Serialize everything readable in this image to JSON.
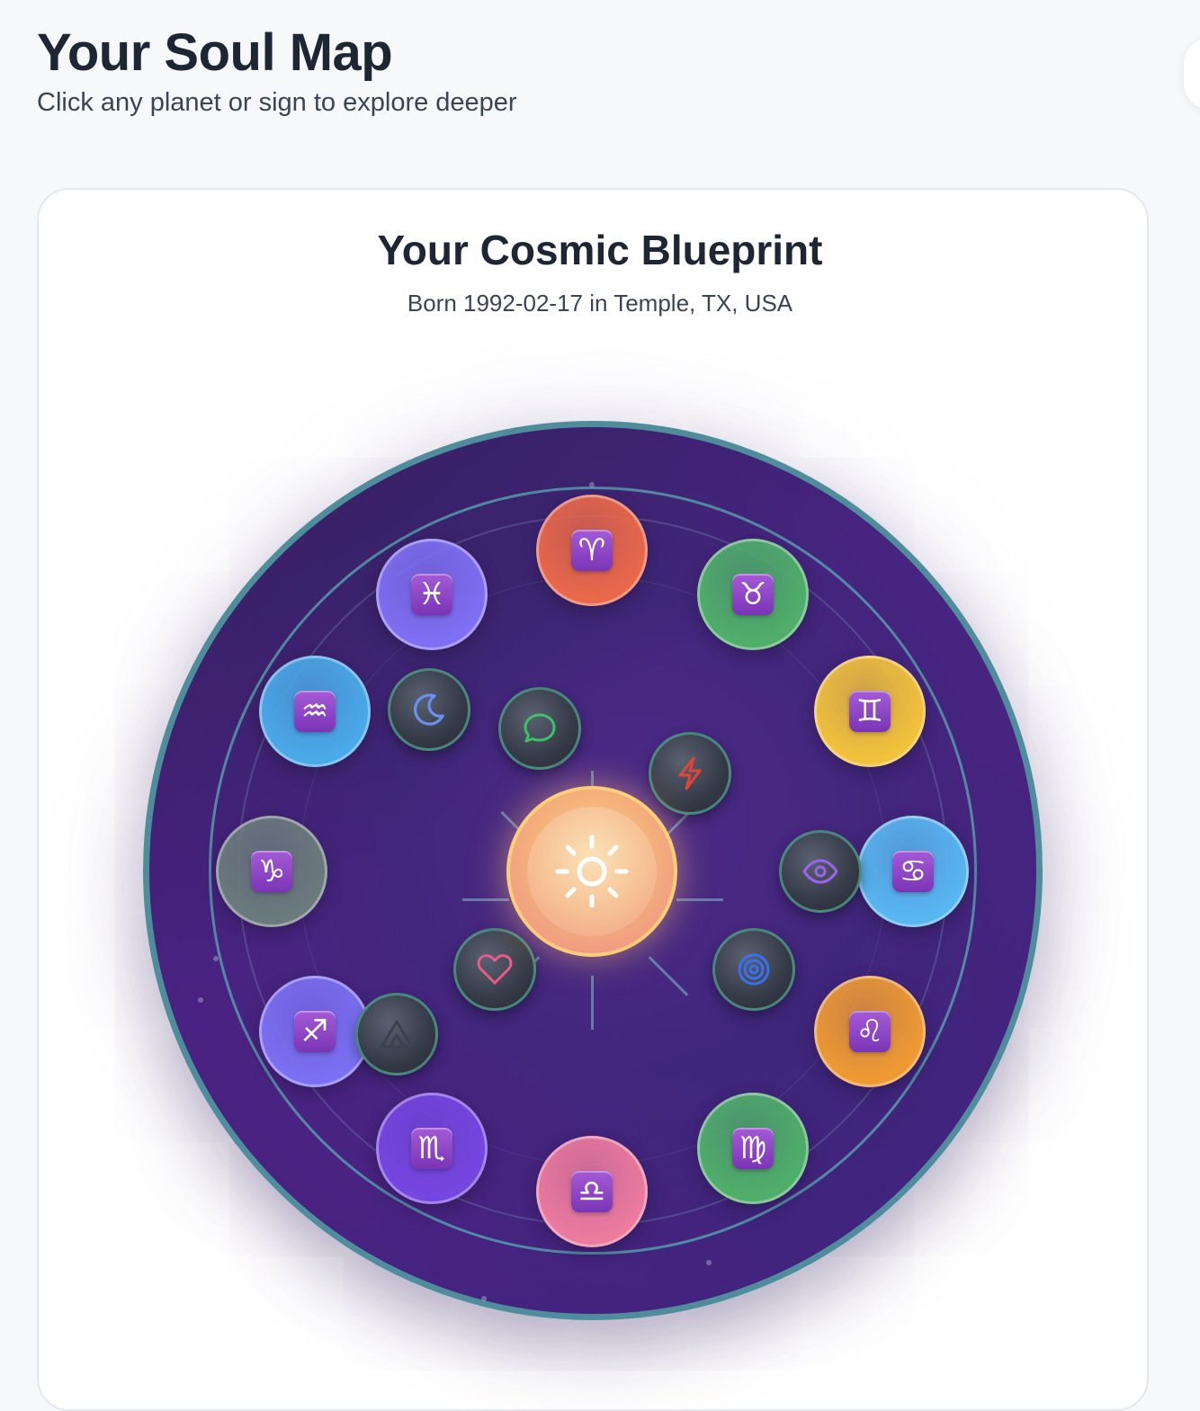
{
  "page": {
    "title": "Your Soul Map",
    "subtitle": "Click any planet or sign to explore deeper"
  },
  "card": {
    "title": "Your Cosmic Blueprint",
    "subtitle": "Born 1992-02-17 in Temple, TX, USA"
  },
  "signs": [
    {
      "name": "aries",
      "glyph": "♈",
      "color": "#e8684a"
    },
    {
      "name": "taurus",
      "glyph": "♉",
      "color": "#4fae6a"
    },
    {
      "name": "gemini",
      "glyph": "♊",
      "color": "#f2c23c"
    },
    {
      "name": "cancer",
      "glyph": "♋",
      "color": "#58b6f0"
    },
    {
      "name": "leo",
      "glyph": "♌",
      "color": "#ee9a34"
    },
    {
      "name": "virgo",
      "glyph": "♍",
      "color": "#4fae6a"
    },
    {
      "name": "libra",
      "glyph": "♎",
      "color": "#ec7b9e"
    },
    {
      "name": "scorpio",
      "glyph": "♏",
      "color": "#7646e0"
    },
    {
      "name": "sagittarius",
      "glyph": "♐",
      "color": "#7b70f2"
    },
    {
      "name": "capricorn",
      "glyph": "♑",
      "color": "#6b7a7c"
    },
    {
      "name": "aquarius",
      "glyph": "♒",
      "color": "#4aa9e8"
    },
    {
      "name": "pisces",
      "glyph": "♓",
      "color": "#7f6ff2"
    }
  ],
  "planets": [
    {
      "name": "sun",
      "icon": "sun-icon",
      "color": "#ffffff"
    },
    {
      "name": "moon",
      "icon": "moon-icon",
      "color": "#6a8ff0"
    },
    {
      "name": "mercury",
      "icon": "chat-bubble-icon",
      "color": "#3fbf6a"
    },
    {
      "name": "mars",
      "icon": "lightning-icon",
      "color": "#e0453a"
    },
    {
      "name": "neptune",
      "icon": "eye-icon",
      "color": "#9a64f0"
    },
    {
      "name": "pluto",
      "icon": "spiral-icon",
      "color": "#3a6ff0"
    },
    {
      "name": "venus",
      "icon": "heart-icon",
      "color": "#ec5a8c"
    },
    {
      "name": "saturn",
      "icon": "mountain-icon",
      "color": "#3c414c"
    }
  ]
}
